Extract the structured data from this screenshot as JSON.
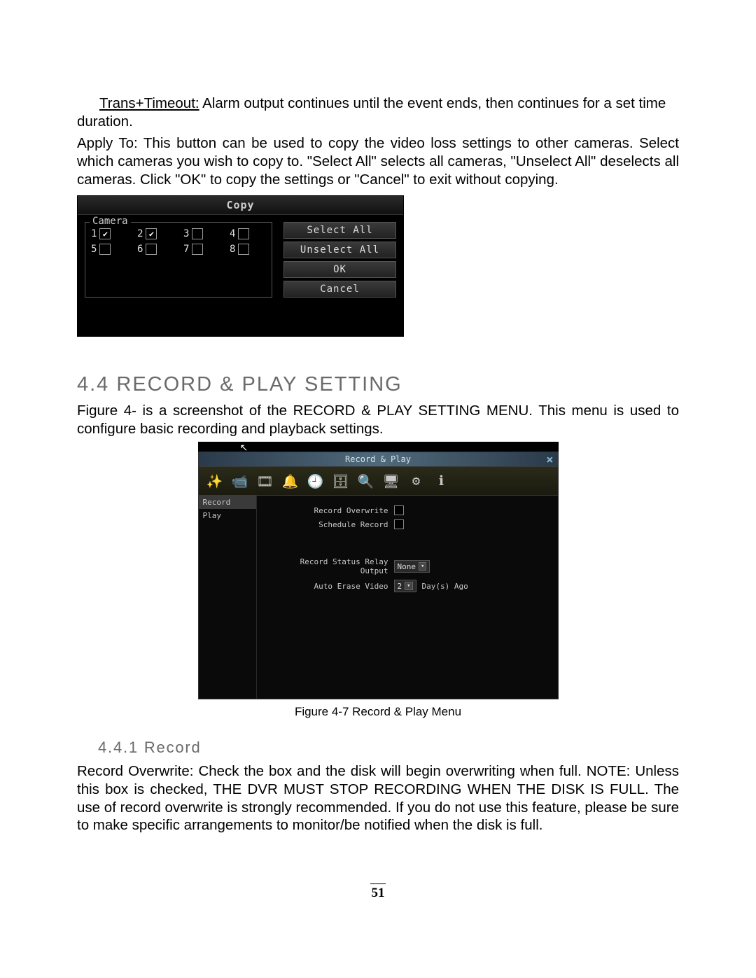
{
  "intro": {
    "trans_label": "Trans+Timeout:",
    "trans_text": " Alarm output continues until the event ends, then continues for a set time duration.",
    "apply_label": "Apply To:",
    "apply_text": " This button can be used to copy the video loss settings to other cameras. Select which cameras you wish to copy to. \"Select All\" selects all cameras, \"Unselect All\" deselects all cameras. Click \"OK\" to copy the settings or \"Cancel\" to exit without copying."
  },
  "copy_dialog": {
    "title": "Copy",
    "legend": "Camera",
    "cameras": [
      {
        "n": "1",
        "checked": true
      },
      {
        "n": "2",
        "checked": true
      },
      {
        "n": "3",
        "checked": false
      },
      {
        "n": "4",
        "checked": false
      },
      {
        "n": "5",
        "checked": false
      },
      {
        "n": "6",
        "checked": false
      },
      {
        "n": "7",
        "checked": false
      },
      {
        "n": "8",
        "checked": false
      }
    ],
    "btn_select_all": "Select All",
    "btn_unselect_all": "Unselect All",
    "btn_ok": "OK",
    "btn_cancel": "Cancel"
  },
  "section44": {
    "heading": "4.4  RECORD & PLAY SETTING",
    "para": "Figure 4- is a screenshot of the RECORD & PLAY SETTING MENU. This menu is used to configure basic recording and playback settings."
  },
  "rp": {
    "title": "Record & Play",
    "side_items": [
      "Record",
      "Play"
    ],
    "row1": "Record Overwrite",
    "row2": "Schedule Record",
    "row3": "Record Status Relay Output",
    "row3_val": "None",
    "row4": "Auto Erase Video",
    "row4_val": "2",
    "row4_suffix": "Day(s) Ago",
    "toolbar_icons": [
      "✨",
      "📹",
      "🎞",
      "🔔",
      "🕘",
      "🗄",
      "🔍",
      "🖥",
      "⚙",
      "ℹ"
    ]
  },
  "figcap": "Figure 4-7  Record & Play Menu",
  "section441": {
    "heading": "4.4.1  Record",
    "para": "Record Overwrite: Check the box and the disk will begin overwriting when full. NOTE: Unless this box is checked, THE DVR MUST STOP RECORDING WHEN THE DISK IS FULL. The use of record overwrite is strongly recommended. If you do not use this feature, please be sure to make specific arrangements to monitor/be notified when the disk is full."
  },
  "page_number": "51"
}
